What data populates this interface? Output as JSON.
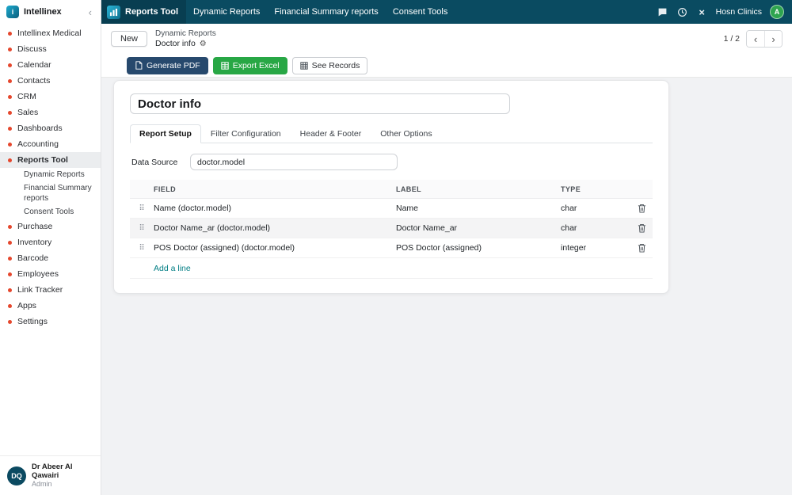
{
  "sidebar": {
    "brand": "Intellinex",
    "items": [
      {
        "label": "Intellinex Medical"
      },
      {
        "label": "Discuss"
      },
      {
        "label": "Calendar"
      },
      {
        "label": "Contacts"
      },
      {
        "label": "CRM"
      },
      {
        "label": "Sales"
      },
      {
        "label": "Dashboards"
      },
      {
        "label": "Accounting"
      },
      {
        "label": "Reports Tool"
      },
      {
        "label": "Purchase"
      },
      {
        "label": "Inventory"
      },
      {
        "label": "Barcode"
      },
      {
        "label": "Employees"
      },
      {
        "label": "Link Tracker"
      },
      {
        "label": "Apps"
      },
      {
        "label": "Settings"
      }
    ],
    "subitems": [
      {
        "label": "Dynamic Reports"
      },
      {
        "label": "Financial Summary reports"
      },
      {
        "label": "Consent Tools"
      }
    ],
    "user": {
      "initials": "DQ",
      "name": "Dr Abeer Al Qawairi",
      "role": "Admin"
    }
  },
  "navbar": {
    "app": "Reports Tool",
    "menus": [
      {
        "label": "Dynamic Reports"
      },
      {
        "label": "Financial Summary reports"
      },
      {
        "label": "Consent Tools"
      }
    ],
    "company": "Hosn Clinics",
    "avatar_initial": "A"
  },
  "breadcrumb": {
    "new_label": "New",
    "parent": "Dynamic Reports",
    "current": "Doctor info",
    "pager": "1 / 2"
  },
  "actions": {
    "generate_pdf": "Generate PDF",
    "export_excel": "Export Excel",
    "see_records": "See Records"
  },
  "form": {
    "title": "Doctor info",
    "tabs": [
      {
        "label": "Report Setup"
      },
      {
        "label": "Filter Configuration"
      },
      {
        "label": "Header & Footer"
      },
      {
        "label": "Other Options"
      }
    ],
    "data_source_label": "Data Source",
    "data_source_value": "doctor.model",
    "table": {
      "headers": [
        {
          "label": "FIELD"
        },
        {
          "label": "LABEL"
        },
        {
          "label": "TYPE"
        }
      ],
      "rows": [
        {
          "field": "Name (doctor.model)",
          "label": "Name",
          "type": "char"
        },
        {
          "field": "Doctor Name_ar (doctor.model)",
          "label": "Doctor Name_ar",
          "type": "char"
        },
        {
          "field": "POS Doctor (assigned) (doctor.model)",
          "label": "POS Doctor (assigned)",
          "type": "integer"
        }
      ],
      "add_line": "Add a line"
    }
  },
  "icons": {
    "drag_handle": "⠿",
    "gear": "⚙",
    "chevron_left": "‹",
    "chevron_right": "›",
    "collapse": "‹",
    "close": "×",
    "logo_letter": "i"
  },
  "colors": {
    "navbar_bg": "#0a4b61",
    "accent_teal": "#017e84",
    "pdf_button": "#27496d",
    "excel_button": "#28a745",
    "bullet_red": "#e5472d",
    "avatar_green": "#2ea44f",
    "user_avatar_navy": "#0b4a61"
  }
}
